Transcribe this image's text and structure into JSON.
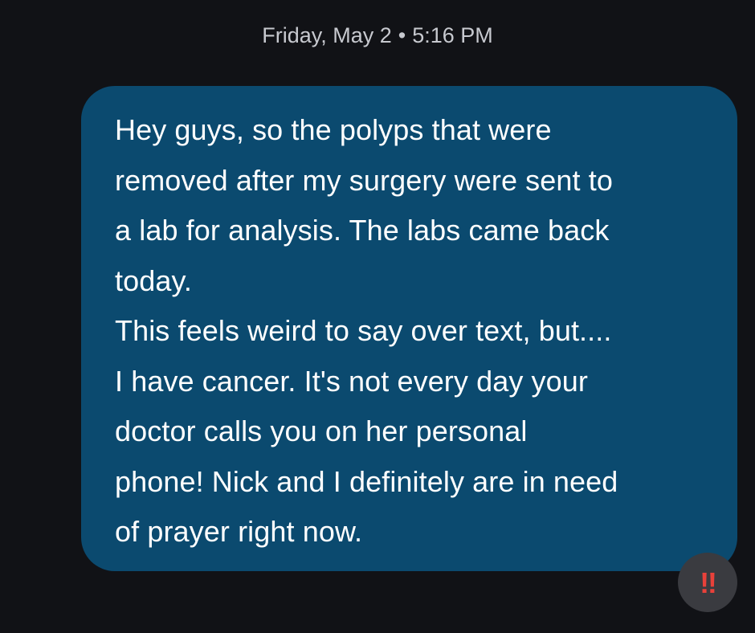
{
  "conversation": {
    "timestamp": {
      "day": "Friday, May 2",
      "separator": "•",
      "time": "5:16 PM"
    },
    "message": {
      "lines": [
        "Hey guys, so the polyps that were",
        "removed after my surgery were sent to",
        "a lab for analysis. The labs came back",
        "today.",
        "This feels weird to say over text, but....",
        "I have cancer. It's not every day your",
        "doctor calls you on her personal",
        "phone! Nick and I definitely are in need",
        "of prayer right now."
      ],
      "bubble_color": "#0b4a6f"
    },
    "reaction": {
      "glyph": "‼",
      "icon": "double-exclamation-icon",
      "color": "#e8413a"
    }
  }
}
